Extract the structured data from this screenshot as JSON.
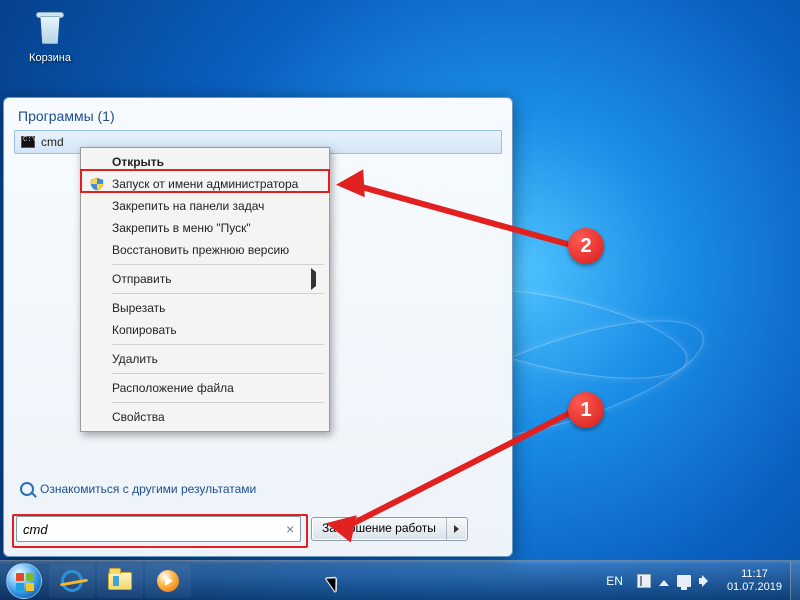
{
  "desktop": {
    "recycle_bin_label": "Корзина"
  },
  "start_panel": {
    "header": "Программы (1)",
    "result_label": "cmd",
    "more_results": "Ознакомиться с другими результатами",
    "search_value": "cmd",
    "shutdown_label": "Завершение работы"
  },
  "context_menu": {
    "open": "Открыть",
    "run_as_admin": "Запуск от имени администратора",
    "pin_taskbar": "Закрепить на панели задач",
    "pin_start": "Закрепить в меню \"Пуск\"",
    "restore_prev": "Восстановить прежнюю версию",
    "send_to": "Отправить",
    "cut": "Вырезать",
    "copy": "Копировать",
    "delete": "Удалить",
    "open_location": "Расположение файла",
    "properties": "Свойства"
  },
  "annotations": {
    "badge1": "1",
    "badge2": "2"
  },
  "taskbar": {
    "lang": "EN",
    "time": "11:17",
    "date": "01.07.2019"
  }
}
